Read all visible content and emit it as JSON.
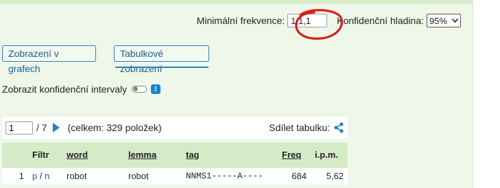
{
  "filters": {
    "min_freq_label": "Minimální frekvence:",
    "min_freq_value": "1,1,1",
    "conf_label": "Konfidenční hladina:",
    "conf_value": "95%"
  },
  "views": {
    "graphs_label": "Zobrazení v grafech",
    "table_label": "Tabulkové zobrazení"
  },
  "confidence_intervals": {
    "label": "Zobrazit konfidenční intervaly",
    "info": "!"
  },
  "pager": {
    "current_page": "1",
    "total_pages": "/ 7",
    "total_items": "(celkem: 329 položek)",
    "share_label": "Sdílet tabulku:"
  },
  "table": {
    "headers": [
      "",
      "Filtr",
      "word",
      "lemma",
      "tag",
      "Freq",
      "i.p.m."
    ],
    "rows": [
      {
        "rank": "1",
        "filter_p": "p",
        "filter_sep": " / ",
        "filter_n": "n",
        "word": "robot",
        "lemma": "robot",
        "tag": "NNMS1-----A----",
        "freq": "684",
        "ipm": "5,62"
      }
    ]
  },
  "colors": {
    "panel_bg": "#eef7e8",
    "header_bg": "#d5ebc7",
    "accent": "#1e7fd6",
    "annotation": "#d81f1f"
  }
}
